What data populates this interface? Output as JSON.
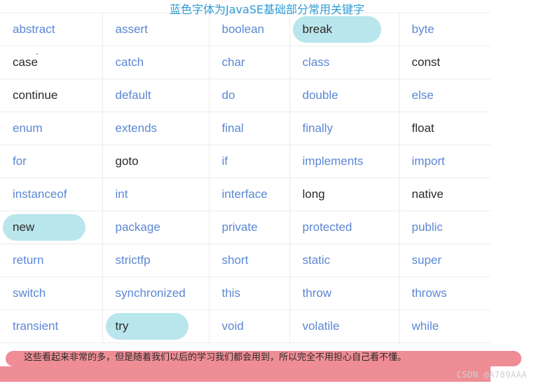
{
  "title": "蓝色字体为JavaSE基础部分常用关键字",
  "colors": {
    "title_blue": "#2e9bd6",
    "keyword_blue": "#5b87d4",
    "keyword_dark": "#2b2b2b",
    "highlight_cyan": "#b9e6ec",
    "notice_pink": "#ef8d95",
    "grid_line": "#ececec",
    "watermark_gray": "#cfcfcf"
  },
  "table": {
    "columns": 5,
    "rows": [
      [
        {
          "text": "abstract",
          "style": "blue",
          "highlight": false
        },
        {
          "text": "assert",
          "style": "blue",
          "highlight": false
        },
        {
          "text": "boolean",
          "style": "blue",
          "highlight": false
        },
        {
          "text": "break",
          "style": "dark",
          "highlight": true
        },
        {
          "text": "byte",
          "style": "blue",
          "highlight": false
        }
      ],
      [
        {
          "text": "case",
          "style": "dark",
          "highlight": false
        },
        {
          "text": "catch",
          "style": "blue",
          "highlight": false
        },
        {
          "text": "char",
          "style": "blue",
          "highlight": false
        },
        {
          "text": "class",
          "style": "blue",
          "highlight": false
        },
        {
          "text": "const",
          "style": "dark",
          "highlight": false
        }
      ],
      [
        {
          "text": "continue",
          "style": "dark",
          "highlight": false
        },
        {
          "text": "default",
          "style": "blue",
          "highlight": false
        },
        {
          "text": "do",
          "style": "blue",
          "highlight": false
        },
        {
          "text": "double",
          "style": "blue",
          "highlight": false
        },
        {
          "text": "else",
          "style": "blue",
          "highlight": false
        }
      ],
      [
        {
          "text": "enum",
          "style": "blue",
          "highlight": false
        },
        {
          "text": "extends",
          "style": "blue",
          "highlight": false
        },
        {
          "text": "final",
          "style": "blue",
          "highlight": false
        },
        {
          "text": "finally",
          "style": "blue",
          "highlight": false
        },
        {
          "text": "float",
          "style": "dark",
          "highlight": false
        }
      ],
      [
        {
          "text": "for",
          "style": "blue",
          "highlight": false
        },
        {
          "text": "goto",
          "style": "dark",
          "highlight": false
        },
        {
          "text": "if",
          "style": "blue",
          "highlight": false
        },
        {
          "text": "implements",
          "style": "blue",
          "highlight": false
        },
        {
          "text": "import",
          "style": "blue",
          "highlight": false
        }
      ],
      [
        {
          "text": "instanceof",
          "style": "blue",
          "highlight": false
        },
        {
          "text": "int",
          "style": "blue",
          "highlight": false
        },
        {
          "text": "interface",
          "style": "blue",
          "highlight": false
        },
        {
          "text": "long",
          "style": "dark",
          "highlight": false
        },
        {
          "text": "native",
          "style": "dark",
          "highlight": false
        }
      ],
      [
        {
          "text": "new",
          "style": "dark",
          "highlight": true
        },
        {
          "text": "package",
          "style": "blue",
          "highlight": false
        },
        {
          "text": "private",
          "style": "blue",
          "highlight": false
        },
        {
          "text": "protected",
          "style": "blue",
          "highlight": false
        },
        {
          "text": "public",
          "style": "blue",
          "highlight": false
        }
      ],
      [
        {
          "text": "return",
          "style": "blue",
          "highlight": false
        },
        {
          "text": "strictfp",
          "style": "blue",
          "highlight": false
        },
        {
          "text": "short",
          "style": "blue",
          "highlight": false
        },
        {
          "text": "static",
          "style": "blue",
          "highlight": false
        },
        {
          "text": "super",
          "style": "blue",
          "highlight": false
        }
      ],
      [
        {
          "text": "switch",
          "style": "blue",
          "highlight": false
        },
        {
          "text": "synchronized",
          "style": "blue",
          "highlight": false
        },
        {
          "text": "this",
          "style": "blue",
          "highlight": false
        },
        {
          "text": "throw",
          "style": "blue",
          "highlight": false
        },
        {
          "text": "throws",
          "style": "blue",
          "highlight": false
        }
      ],
      [
        {
          "text": "transient",
          "style": "blue",
          "highlight": false
        },
        {
          "text": "try",
          "style": "dark",
          "highlight": true
        },
        {
          "text": "void",
          "style": "blue",
          "highlight": false
        },
        {
          "text": "volatile",
          "style": "blue",
          "highlight": false
        },
        {
          "text": "while",
          "style": "blue",
          "highlight": false
        }
      ]
    ]
  },
  "notice": {
    "text": "这些看起来非常的多，但是随着我们以后的学习我们都会用到，所以完全不用担心自己看不懂。"
  },
  "watermark": "CSDN @A789AAA"
}
